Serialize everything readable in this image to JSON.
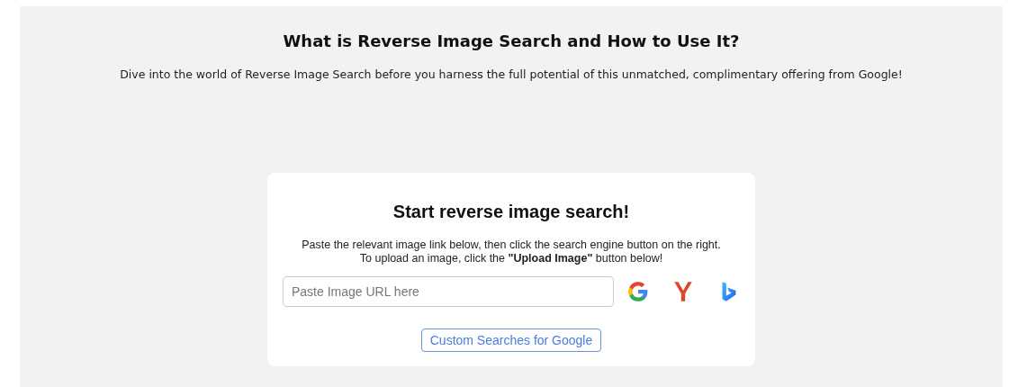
{
  "heading": "What is Reverse Image Search and How to Use It?",
  "intro": "Dive into the world of Reverse Image Search before you harness the full potential of this unmatched, complimentary offering from Google!",
  "card": {
    "title": "Start reverse image search!",
    "instructions": [
      "Paste the relevant image link below, then click the search engine button on the right.",
      "To upload an image, click the **\"Upload Image\"** button below!"
    ],
    "search": {
      "placeholder": "Paste Image URL here"
    },
    "engines": [
      {
        "kind": "google"
      },
      {
        "kind": "yandex"
      },
      {
        "kind": "bing"
      }
    ],
    "button": "Custom Searches for Google"
  }
}
